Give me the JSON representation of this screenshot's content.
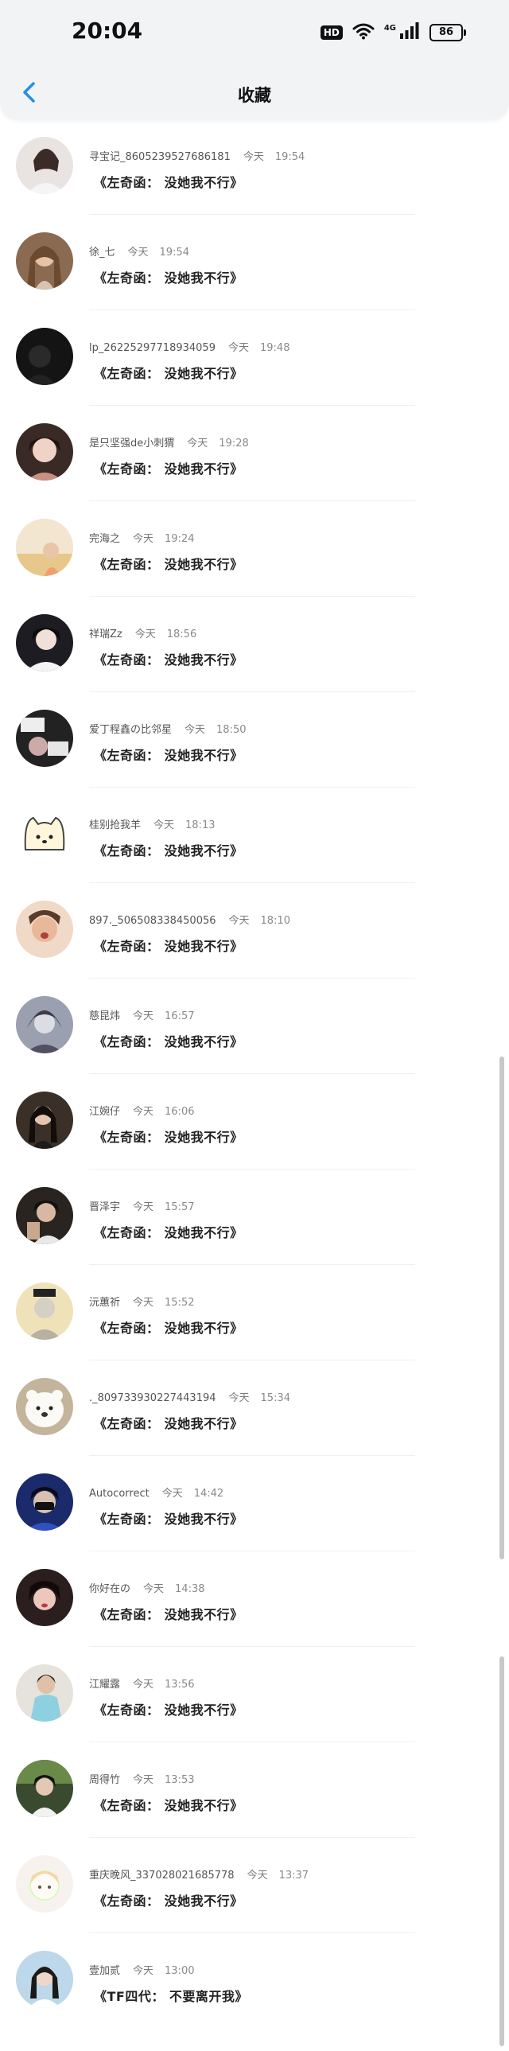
{
  "status_bar": {
    "time": "20:04",
    "hd": "HD",
    "network": "4G",
    "battery": "86"
  },
  "nav": {
    "title": "收藏",
    "accent_color": "#2a8de0"
  },
  "items": [
    {
      "name": "寻宝记_8605239527686181",
      "day": "今天",
      "time": "19:54",
      "content": "《左奇函： 没她我不行》"
    },
    {
      "name": "徐_七",
      "day": "今天",
      "time": "19:54",
      "content": "《左奇函： 没她我不行》"
    },
    {
      "name": "lp_26225297718934059",
      "day": "今天",
      "time": "19:48",
      "content": "《左奇函： 没她我不行》"
    },
    {
      "name": "是只坚强de小刺猬",
      "day": "今天",
      "time": "19:28",
      "content": "《左奇函： 没她我不行》"
    },
    {
      "name": "完海之",
      "day": "今天",
      "time": "19:24",
      "content": "《左奇函： 没她我不行》"
    },
    {
      "name": "祥瑞Zz",
      "day": "今天",
      "time": "18:56",
      "content": "《左奇函： 没她我不行》"
    },
    {
      "name": "爱丁程鑫の比邻星",
      "day": "今天",
      "time": "18:50",
      "content": "《左奇函： 没她我不行》"
    },
    {
      "name": "桂别抢我羊",
      "day": "今天",
      "time": "18:13",
      "content": "《左奇函： 没她我不行》"
    },
    {
      "name": "897._506508338450056",
      "day": "今天",
      "time": "18:10",
      "content": "《左奇函： 没她我不行》"
    },
    {
      "name": "慈昆炜",
      "day": "今天",
      "time": "16:57",
      "content": "《左奇函： 没她我不行》"
    },
    {
      "name": "江婉仔",
      "day": "今天",
      "time": "16:06",
      "content": "《左奇函： 没她我不行》"
    },
    {
      "name": "晋泽宇",
      "day": "今天",
      "time": "15:57",
      "content": "《左奇函： 没她我不行》"
    },
    {
      "name": "沅蕙祈",
      "day": "今天",
      "time": "15:52",
      "content": "《左奇函： 没她我不行》"
    },
    {
      "name": "._8097339302274431​94",
      "day": "今天",
      "time": "15:34",
      "content": "《左奇函： 没她我不行》"
    },
    {
      "name": "Autocorrect",
      "day": "今天",
      "time": "14:42",
      "content": "《左奇函： 没她我不行》"
    },
    {
      "name": "你好在の",
      "day": "今天",
      "time": "14:38",
      "content": "《左奇函： 没她我不行》"
    },
    {
      "name": "江耀露",
      "day": "今天",
      "time": "13:56",
      "content": "《左奇函： 没她我不行》"
    },
    {
      "name": "周得竹",
      "day": "今天",
      "time": "13:53",
      "content": "《左奇函： 没她我不行》"
    },
    {
      "name": "重庆晚风_337028021685778",
      "day": "今天",
      "time": "13:37",
      "content": "《左奇函： 没她我不行》"
    },
    {
      "name": "壹加贰",
      "day": "今天",
      "time": "13:00",
      "content": "《TF四代： 不要离开我》"
    }
  ]
}
